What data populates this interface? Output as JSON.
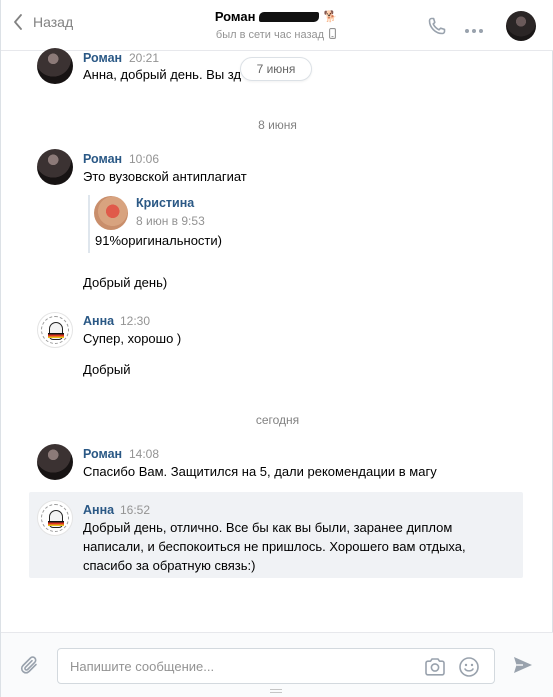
{
  "header": {
    "back_label": "Назад",
    "contact_name": "Роман",
    "dog_emoji": "🐕",
    "status": "был в сети час назад",
    "icons": {
      "back": "chevron-left-icon",
      "call": "phone-icon",
      "more": "more-icon",
      "device": "phone-device-icon"
    }
  },
  "date_pill": "7 июня",
  "messages": [
    {
      "sender": "Роман",
      "time": "20:21",
      "text": "Анна, добрый день. Вы зд"
    },
    {
      "date_separator": "8 июня"
    },
    {
      "sender": "Роман",
      "time": "10:06",
      "text": "Это вузовской антиплагиат",
      "forwarded": {
        "sender": "Кристина",
        "date": "8 июн в 9:53",
        "text": "91%оригинальности)"
      }
    },
    {
      "text": "Добрый день)"
    },
    {
      "sender": "Анна",
      "time": "12:30",
      "text": "Супер, хорошо )"
    },
    {
      "text": "Добрый"
    },
    {
      "date_separator": "сегодня"
    },
    {
      "sender": "Роман",
      "time": "14:08",
      "text": "Спасибо Вам. Защитился на 5, дали рекомендации в магу"
    },
    {
      "sender": "Анна",
      "time": "16:52",
      "lines": [
        "Добрый день, отлично. Все бы как вы были, заранее диплом",
        "написали, и беспокоиться не пришлось. Хорошего вам отдыха,",
        "спасибо за обратную связь:)"
      ]
    }
  ],
  "composer": {
    "placeholder": "Напишите сообщение...",
    "icons": {
      "attach": "paperclip-icon",
      "camera": "camera-icon",
      "emoji": "smile-icon",
      "send": "send-icon"
    }
  },
  "colors": {
    "accent": "#2a5885",
    "muted": "#939393",
    "highlight_bg": "#f0f2f5"
  }
}
